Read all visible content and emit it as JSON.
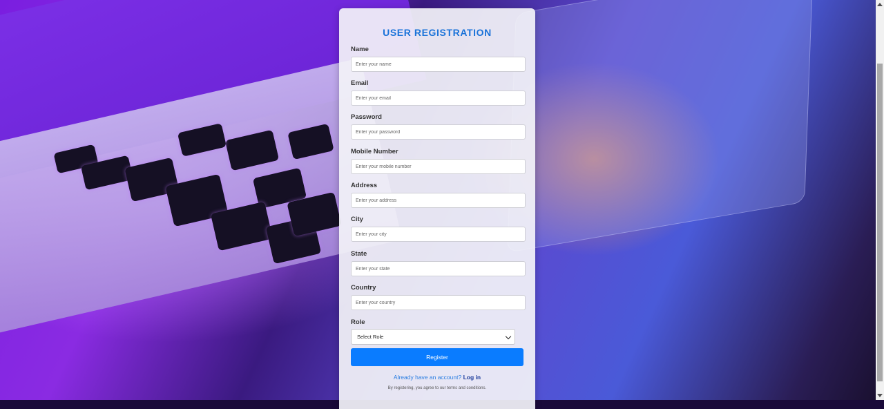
{
  "form": {
    "title": "USER REGISTRATION",
    "fields": [
      {
        "label": "Name",
        "placeholder": "Enter your name"
      },
      {
        "label": "Email",
        "placeholder": "Enter your email"
      },
      {
        "label": "Password",
        "placeholder": "Enter your password"
      },
      {
        "label": "Mobile Number",
        "placeholder": "Enter your mobile number"
      },
      {
        "label": "Address",
        "placeholder": "Enter your address"
      },
      {
        "label": "City",
        "placeholder": "Enter your city"
      },
      {
        "label": "State",
        "placeholder": "Enter your state"
      },
      {
        "label": "Country",
        "placeholder": "Enter your country"
      }
    ],
    "role": {
      "label": "Role",
      "selected": "Select Role"
    },
    "register_label": "Register",
    "login_prompt": "Already have an account?",
    "login_link": "Log in",
    "terms": "By registering, you agree to our terms and conditions."
  },
  "colors": {
    "accent": "#0a7cff",
    "title": "#1a73d9",
    "link": "#2a7de1"
  }
}
